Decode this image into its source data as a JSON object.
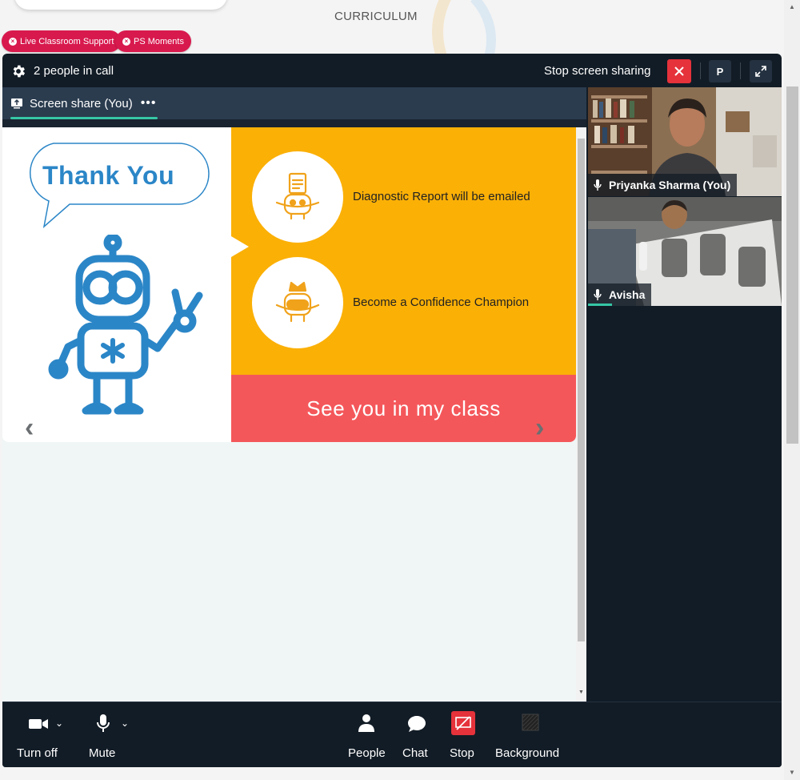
{
  "page": {
    "section_title": "CURRICULUM",
    "pills": [
      {
        "label": "Live Classroom Support"
      },
      {
        "label": "PS Moments"
      }
    ]
  },
  "call": {
    "people_count_text": "2 people in call",
    "stop_sharing_label": "Stop screen sharing",
    "profile_initial": "P",
    "tab_label": "Screen share (You)",
    "tab_more": "•••",
    "slide": {
      "bubble_text": "Thank You",
      "items": [
        {
          "text": "Diagnostic Report will be emailed"
        },
        {
          "text": "Become a Confidence Champion"
        }
      ],
      "banner_text": "See you in my class",
      "prev_arrow": "‹",
      "next_arrow": "›"
    },
    "participants": [
      {
        "name": "Priyanka Sharma (You)"
      },
      {
        "name": "Avisha"
      }
    ],
    "controls": [
      {
        "label": "Turn off",
        "icon": "camera-icon"
      },
      {
        "label": "Mute",
        "icon": "microphone-icon"
      },
      {
        "label": "People",
        "icon": "people-icon"
      },
      {
        "label": "Chat",
        "icon": "chat-icon"
      },
      {
        "label": "Stop",
        "icon": "stop-share-icon"
      },
      {
        "label": "Background",
        "icon": "background-icon"
      }
    ],
    "colors": {
      "accent_teal": "#36c6a6",
      "stop_red": "#e5323b",
      "slide_yellow": "#fbb006",
      "slide_red": "#f4575a",
      "robot_blue": "#2b86c7"
    }
  }
}
